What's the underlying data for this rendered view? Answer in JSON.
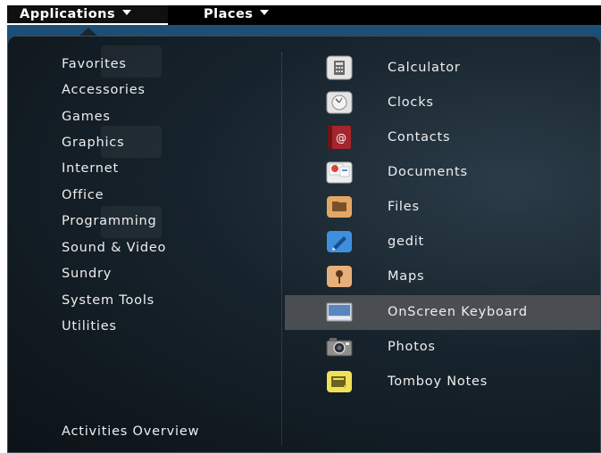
{
  "topbar": {
    "applications_label": "Applications",
    "places_label": "Places"
  },
  "categories": [
    "Favorites",
    "Accessories",
    "Games",
    "Graphics",
    "Internet",
    "Office",
    "Programming",
    "Sound & Video",
    "Sundry",
    "System Tools",
    "Utilities"
  ],
  "activities_overview": "Activities Overview",
  "apps": [
    {
      "label": "Calculator",
      "icon": "calculator-icon"
    },
    {
      "label": "Clocks",
      "icon": "clock-icon"
    },
    {
      "label": "Contacts",
      "icon": "contacts-icon"
    },
    {
      "label": "Documents",
      "icon": "documents-icon"
    },
    {
      "label": "Files",
      "icon": "folder-icon"
    },
    {
      "label": "gedit",
      "icon": "gedit-icon"
    },
    {
      "label": "Maps",
      "icon": "map-pin-icon"
    },
    {
      "label": "OnScreen Keyboard",
      "icon": "keyboard-icon"
    },
    {
      "label": "Photos",
      "icon": "camera-icon"
    },
    {
      "label": "Tomboy Notes",
      "icon": "note-icon"
    }
  ],
  "selected_app": "OnScreen Keyboard"
}
